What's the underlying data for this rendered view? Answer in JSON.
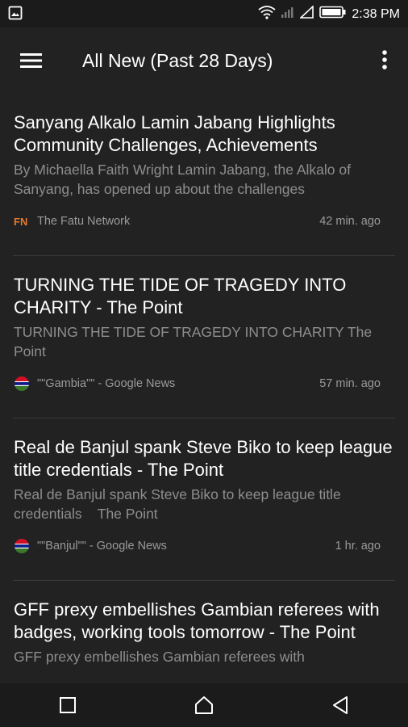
{
  "status_bar": {
    "time": "2:38 PM",
    "left_icon": "image-icon",
    "icons": [
      "wifi-icon",
      "signal-icon",
      "battery-icon"
    ]
  },
  "app_bar": {
    "title": "All New (Past 28 Days)",
    "menu_icon": "hamburger-menu-icon",
    "overflow_icon": "more-vert-icon"
  },
  "articles": [
    {
      "title": "Sanyang Alkalo Lamin Jabang Highlights Community Challenges, Achievements",
      "summary": "By Michaella Faith Wright Lamin Jabang, the Alkalo of Sanyang, has opened up about the challenges",
      "source": "The Fatu Network",
      "source_icon": "fatu-network-icon",
      "time": "42 min. ago"
    },
    {
      "title": "TURNING THE TIDE OF TRAGEDY INTO CHARITY - The Point",
      "summary": "TURNING THE TIDE OF TRAGEDY INTO CHARITY The Point",
      "source": "\"\"Gambia\"\" - Google News",
      "source_icon": "gambia-flag-icon",
      "time": "57 min. ago"
    },
    {
      "title": "Real de Banjul spank Steve Biko to keep league title credentials - The Point",
      "summary": "Real de Banjul spank Steve Biko to keep league title credentials    The Point",
      "source": "\"\"Banjul\"\" - Google News",
      "source_icon": "gambia-flag-icon",
      "time": "1 hr. ago"
    },
    {
      "title": "GFF prexy embellishes Gambian referees with badges, working tools tomorrow - The Point",
      "summary": "GFF prexy embellishes Gambian referees with",
      "source": "",
      "source_icon": "",
      "time": ""
    }
  ],
  "nav_bar": {
    "buttons": [
      "recents-square-icon",
      "home-icon",
      "back-triangle-icon"
    ]
  },
  "colors": {
    "background": "#222222",
    "status_bar": "#1b1b1b",
    "title_text": "#ffffff",
    "summary_text": "#8e8e8e",
    "divider": "#3a3a3a"
  }
}
